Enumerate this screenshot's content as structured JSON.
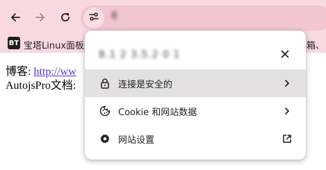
{
  "toolbar": {
    "back_icon": "back-arrow-icon",
    "forward_icon": "forward-arrow-icon",
    "reload_icon": "reload-icon",
    "site_info_icon": "tune-icon",
    "url_blurred": "8        "
  },
  "bookmarks": {
    "item1_icon_text": "BT",
    "item1_label": "宝塔Linux面板-",
    "right_fragment": "箱、"
  },
  "page": {
    "line1_label": "博客: ",
    "line1_link": "http://ww",
    "line2_label": "AutojsPro文档:"
  },
  "site_popup": {
    "title_blurred": "8.1 2 3.5.2 0 1",
    "close_icon": "close-icon",
    "items": [
      {
        "label": "连接是安全的",
        "icon": "lock-icon",
        "right_icon": "chevron-right-icon",
        "active": true
      },
      {
        "label": "Cookie 和网站数据",
        "icon": "cookie-icon",
        "right_icon": "chevron-right-icon",
        "active": false
      },
      {
        "label": "网站设置",
        "icon": "gear-icon",
        "right_icon": "external-link-icon",
        "active": false
      }
    ]
  },
  "colors": {
    "toolbar_bg": "#f8d9df",
    "omnibox_bg": "#f1c6cf",
    "active_row": "#e2e0e1",
    "link": "#4a3bd0"
  }
}
